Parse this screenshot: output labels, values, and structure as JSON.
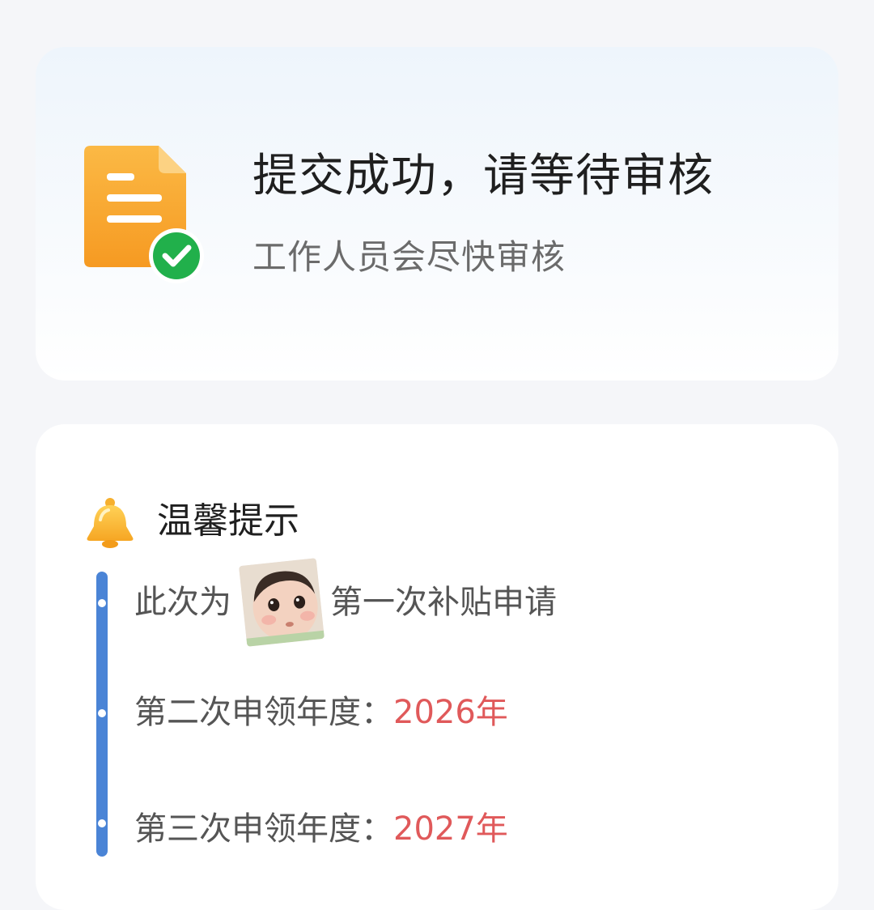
{
  "status": {
    "title": "提交成功，请等待审核",
    "subtitle": "工作人员会尽快审核",
    "icon": "document-check-icon"
  },
  "tips": {
    "title": "温馨提示",
    "icon": "bell-icon",
    "items": [
      {
        "prefix": "此次为",
        "sticker": "baby-face-sticker",
        "suffix": "第一次补贴申请"
      },
      {
        "label": "第二次申领年度：",
        "value": "2026年"
      },
      {
        "label": "第三次申领年度：",
        "value": "2027年"
      }
    ]
  },
  "colors": {
    "accent_orange": "#f8a734",
    "success_green": "#21b04b",
    "timeline_blue": "#4a84d6",
    "highlight_red": "#e0595a"
  }
}
